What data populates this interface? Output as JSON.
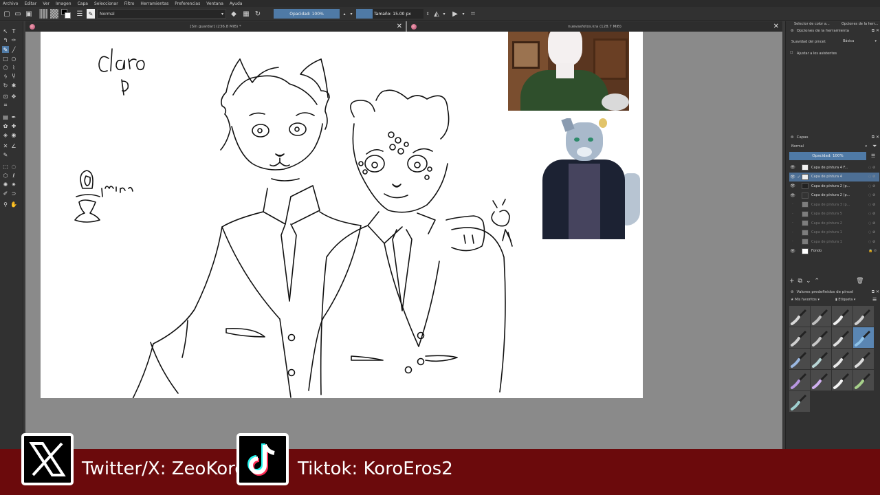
{
  "menu": [
    "Archivo",
    "Editar",
    "Ver",
    "Imagen",
    "Capa",
    "Seleccionar",
    "Filtro",
    "Herramientas",
    "Preferencias",
    "Ventana",
    "Ayuda"
  ],
  "toolbar": {
    "blend_mode": "Normal",
    "opacity_label": "Opacidad: 100%",
    "size_label": "Tamaño: 15.00 px"
  },
  "documents": {
    "tab1_title": "[Sin guardar] (236.8 MiB) *",
    "tab2_title": "nuevasfotos.kra (128.7 MiB)"
  },
  "canvas_text": {
    "note1": "Claro",
    "note2": "1min"
  },
  "docker": {
    "top_tabs": [
      "Selector de color a...",
      "Opciones de la herr..."
    ],
    "tool_options_title": "Opciones de la herramienta",
    "smoothing_label": "Suavidad del pincel:",
    "smoothing_value": "Básica",
    "assistants_label": "Ajustar a los asistentes",
    "layers_title": "Capas",
    "layer_blend": "Normal",
    "layer_opacity": "Opacidad:  100%",
    "layers": [
      {
        "name": "Capa de pintura 4 F...",
        "visible": true,
        "selected": false
      },
      {
        "name": "Capa de pintura 4",
        "visible": true,
        "selected": true
      },
      {
        "name": "Capa de pintura 2 (p...",
        "visible": true,
        "selected": false
      },
      {
        "name": "Capa de pintura 2 (p...",
        "visible": true,
        "selected": false
      },
      {
        "name": "Capa de pintura 3 (p...",
        "visible": false,
        "selected": false
      },
      {
        "name": "Capa de pintura 5",
        "visible": false,
        "selected": false
      },
      {
        "name": "Capa de pintura 2",
        "visible": false,
        "selected": false
      },
      {
        "name": "Capa de pintura 1",
        "visible": false,
        "selected": false
      },
      {
        "name": "Capa de pintura 1",
        "visible": false,
        "selected": false
      },
      {
        "name": "Fondo",
        "visible": true,
        "selected": false
      }
    ],
    "presets_title": "Valores predefinidos de pincel",
    "presets_tag": "Mis favoritos",
    "presets_filter": "Etiqueta"
  },
  "banner": {
    "twitter": "Twitter/X: ZeoKoro",
    "tiktok": "Tiktok: KoroEros2",
    "colors": {
      "background": "#6b0a0c",
      "text": "#ffffff"
    }
  }
}
